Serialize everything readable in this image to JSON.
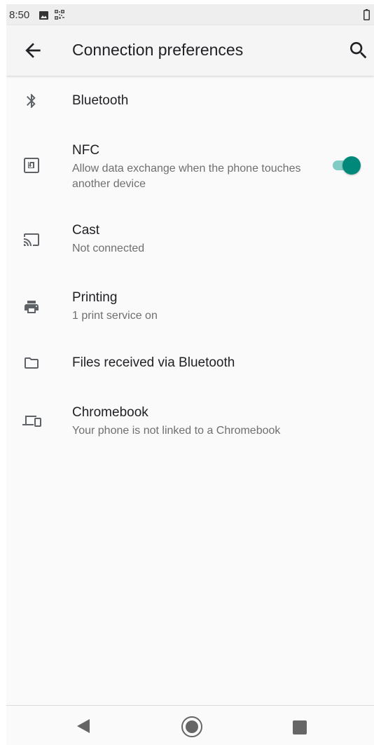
{
  "status_bar": {
    "time": "8:50",
    "icons": [
      "image-icon",
      "qr-code-icon",
      "battery-icon"
    ]
  },
  "app_bar": {
    "title": "Connection preferences",
    "back_icon": "arrow-back-icon",
    "search_icon": "search-icon"
  },
  "items": [
    {
      "title": "Bluetooth",
      "summary": "",
      "icon": "bluetooth-icon"
    },
    {
      "title": "NFC",
      "summary": "Allow data exchange when the phone touches another device",
      "icon": "nfc-icon",
      "toggle_on": true
    },
    {
      "title": "Cast",
      "summary": "Not connected",
      "icon": "cast-icon"
    },
    {
      "title": "Printing",
      "summary": "1 print service on",
      "icon": "printer-icon"
    },
    {
      "title": "Files received via Bluetooth",
      "summary": "",
      "icon": "folder-icon"
    },
    {
      "title": "Chromebook",
      "summary": "Your phone is not linked to a Chromebook",
      "icon": "laptop-phone-icon"
    }
  ],
  "nav_bar": {
    "icons": [
      "nav-back-icon",
      "nav-home-icon",
      "nav-recents-icon"
    ]
  },
  "colors": {
    "accent": "#00897b",
    "accent_track": "#80cbc4",
    "icon": "#5f6368",
    "title": "#202124",
    "summary": "#6f6f6f",
    "status_bar": "#eeeeee",
    "app_bar": "#f5f5f5",
    "background": "#fafafa"
  }
}
